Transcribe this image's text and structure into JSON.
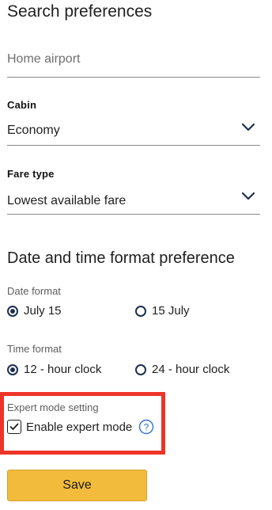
{
  "search": {
    "title": "Search preferences",
    "home_airport_placeholder": "Home airport",
    "cabin_label": "Cabin",
    "cabin_value": "Economy",
    "fare_label": "Fare type",
    "fare_value": "Lowest available fare"
  },
  "datetime": {
    "title": "Date and time format preference",
    "date_label": "Date format",
    "date_options": [
      "July 15",
      "15 July"
    ],
    "date_selected": "July 15",
    "time_label": "Time format",
    "time_options": [
      "12 - hour clock",
      "24 - hour clock"
    ],
    "time_selected": "12 - hour clock"
  },
  "expert": {
    "label": "Expert mode setting",
    "checkbox_label": "Enable expert mode",
    "checked": true,
    "help_icon": "help-circle-icon",
    "highlight_color": "#ee3429"
  },
  "actions": {
    "save_label": "Save",
    "save_color": "#f3bb3b"
  },
  "icons": {
    "dropdown": "chevron-down-icon",
    "check": "checkmark-icon"
  },
  "colors": {
    "accent": "#1d2f4f"
  }
}
